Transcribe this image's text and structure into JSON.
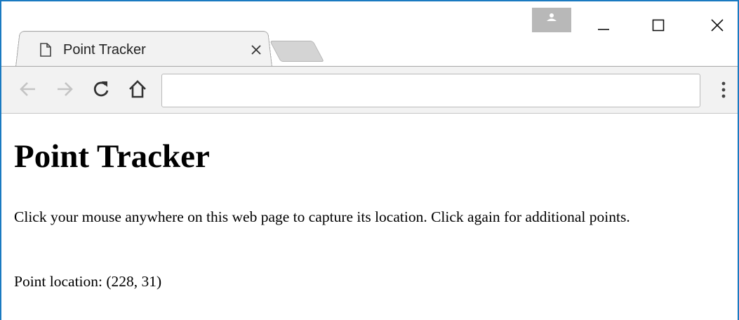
{
  "browser": {
    "tab": {
      "title": "Point Tracker",
      "close_symbol": "×"
    },
    "address_bar": {
      "value": "",
      "placeholder": ""
    },
    "icons": {
      "tab_page": "page-icon",
      "profile": "profile-icon",
      "minimize": "minimize-icon",
      "maximize": "maximize-icon",
      "close": "close-icon",
      "back": "back-arrow-icon",
      "forward": "forward-arrow-icon",
      "reload": "reload-icon",
      "home": "home-icon",
      "menu": "kebab-menu-icon"
    },
    "colors": {
      "window_border": "#1a7ac1",
      "toolbar_bg": "#f2f2f2",
      "tab_bg": "#f2f2f2",
      "profile_bg": "#b8b8b8"
    }
  },
  "page": {
    "heading": "Point Tracker",
    "instructions": "Click your mouse anywhere on this web page to capture its location. Click again for additional points.",
    "point_location_label": "Point location:",
    "point_location_value": "(228, 31)"
  }
}
